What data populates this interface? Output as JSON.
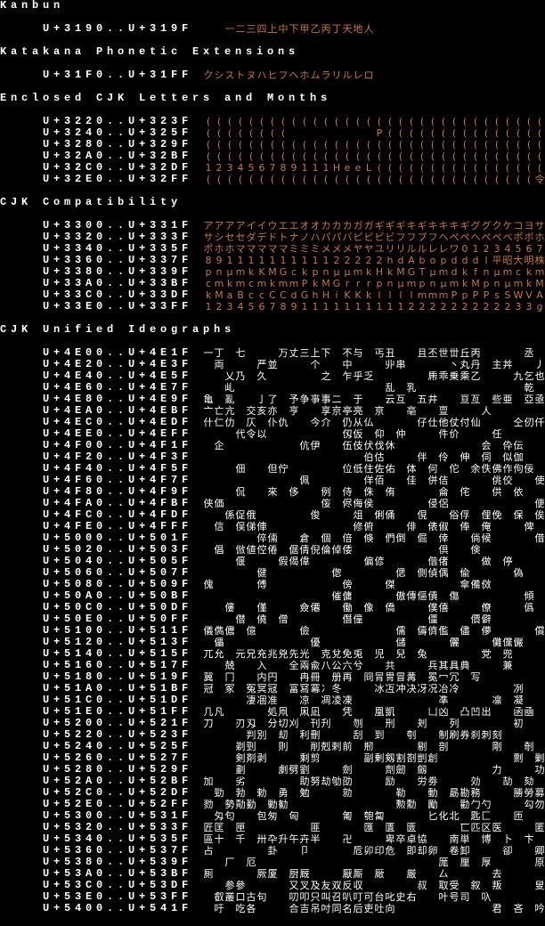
{
  "colors": {
    "background": "#000000",
    "label": "#ffffff",
    "sample_orange": "#c8783a",
    "sample_white": "#ffffff"
  },
  "sections": [
    {
      "title": "Kanbun",
      "color": "#c8783a",
      "rows": [
        {
          "range": "U+3190..U+319F",
          "glyphs": "　　一二三四上中下甲乙丙丁天地人"
        }
      ]
    },
    {
      "title": "Katakana Phonetic Extensions",
      "color": "#c8783a",
      "rows": [
        {
          "range": "U+31F0..U+31FF",
          "glyphs": "クシストヌハヒフヘホムラリルレロ"
        }
      ]
    },
    {
      "title": "Enclosed CJK Letters and Months",
      "color": "#c8783a",
      "rows": [
        {
          "range": "U+3220..U+323F",
          "glyphs": "(((((((((((((((((((((((((((((((("
        },
        {
          "range": "U+3240..U+325F",
          "glyphs": "((((((((　　　　　　　　P((((((((((((((("
        },
        {
          "range": "U+3280..U+329F",
          "glyphs": "(((((((((((((((((((((((((((((((("
        },
        {
          "range": "U+32A0..U+32BF",
          "glyphs": "(((((((((((((((((((((((((((((((("
        },
        {
          "range": "U+32C0..U+32DF",
          "glyphs": "123456789111HeeL(((((((((((((((("
        },
        {
          "range": "U+32E0..U+32FF",
          "glyphs": "(((((((((((((((((((((((((((((((令"
        }
      ]
    },
    {
      "title": "CJK Compatibility",
      "color": "#c8783a",
      "rows": [
        {
          "range": "U+3300..U+331F",
          "glyphs": "アアアアイイウエエオオカカカガガギギギキギキキキギググクケコヨサ"
        },
        {
          "range": "U+3320..U+333F",
          "glyphs": "サシセセダデドトナノハパパバピピピビフフプフヘペペヘペペベポボホ"
        },
        {
          "range": "U+3340..U+335F",
          "glyphs": "ポホホマママママミミミメメメヤヤユリリルルレレワ01234567"
        },
        {
          "range": "U+3360..U+337F",
          "glyphs": "89111111111122222hdAbopdddI平昭大明株"
        },
        {
          "range": "U+3380..U+339F",
          "glyphs": "pnμmkKMGckpnμμmkHkMGTμmdkfnμmckm"
        },
        {
          "range": "U+33A0..U+33BF",
          "glyphs": "cmkmcmkmmPkMGrrrpnμmpnμmkMpnμmkM"
        },
        {
          "range": "U+33C0..U+33DF",
          "glyphs": "kMaBccCCdGhHiKKkllllmmmPpPPsSWVA"
        },
        {
          "range": "U+33E0..U+33FF",
          "glyphs": "1234567891111111111222222222233g"
        }
      ]
    },
    {
      "title": "CJK Unified Ideographs",
      "color": "#ffffff",
      "rows": [
        {
          "range": "U+4E00..U+4E1F",
          "glyphs": "一丁　七　　　万丈三上下　不与　丐丑　　且丕世丗丘丙　　　　丞　"
        },
        {
          "range": "U+4E20..U+4E3F",
          "glyphs": "　両　　　严並　　　个　　中　　　丱串　　　　丶丸丹　主丼　　丿"
        },
        {
          "range": "U+4E40..U+4E5F",
          "glyphs": "　　乂乃　久　　　　　之　乍乎乏　　　　　乕乖乗乘乙　　　九乞也"
        },
        {
          "range": "U+4E60..U+4E7F",
          "glyphs": "　　乢　　　　　　　　　　　　　　乱　乳　　　　　　　　　　乾　"
        },
        {
          "range": "U+4E80..U+4E9F",
          "glyphs": "亀　亂　　亅了　予争亊事二　于　　云互　五井　　亘亙　些亜　亞亟"
        },
        {
          "range": "U+4EA0..U+4EBF",
          "glyphs": "亠亡亢　交亥亦　亨　　享京亭亮　亰　　亳　　亶　　　人　　　　　"
        },
        {
          "range": "U+4EC0..U+4EDF",
          "glyphs": "什仁仂　仄　仆仇　　今介　仍从仏　　　　仔仕他仗付仙　　　仝仞仟"
        },
        {
          "range": "U+4EE0..U+4EFF",
          "glyphs": "　　　代令以　　　　　　　仭仮　仰　仲　　　件价　　　任　　　　"
        },
        {
          "range": "U+4F00..U+4F1F",
          "glyphs": "　企　　　　　　　伉伊　　伍伎伏伐休　　　　　　　　会　伜伝　　"
        },
        {
          "range": "U+4F20..U+4F3F",
          "glyphs": "　　　　　　　　　　　　　　　伯估　　　伴　伶　伸　伺　似伽　　"
        },
        {
          "range": "U+4F40..U+4F5F",
          "glyphs": "　　　佃　　但佇　　　　　位低住佐佑　体　何　佗　余佚佛作佝佞　"
        },
        {
          "range": "U+4F60..U+4F7F",
          "glyphs": "　　　　　　　　　佩　　　　　佯佰　　佳　併佶　　　　佻佼　　使"
        },
        {
          "range": "U+4F80..U+4F9F",
          "glyphs": "　　　侃　　來　侈　　例　侍　侏　侑　　　　侖　侘　　供　依　　"
        },
        {
          "range": "U+4FA0..U+4FBF",
          "glyphs": "侠価　　　　　　　　　侫　侭侮侯　　　　　侵侶　　　　　　　　便"
        },
        {
          "range": "U+4FC0..U+4FDF",
          "glyphs": "　　係促俄　　　　　俊　　　俎　俐俑　　俔　　俗俘　俚俛　保　俟"
        },
        {
          "range": "U+4FE0..U+4FFF",
          "glyphs": "　信　俣俤俥　　　　　　　　修俯　　　俳　俵俶　俸　俺　　　俾　"
        },
        {
          "range": "U+5000..U+501F",
          "glyphs": "　　　　　倅倆　　倉　個　倍　倏　們倒　倔　倖　　倘候　　　　借"
        },
        {
          "range": "U+5020..U+503F",
          "glyphs": "　倡　倣値倥倦　倨倩倪倫倬倭　　　　　　　　倶　　倹　　　　　　"
        },
        {
          "range": "U+5040..U+505F",
          "glyphs": "　　　偃　　　假偈偉　　　　　偏偐　　　　偕偖　　　做　停　　　"
        },
        {
          "range": "U+5060..U+507F",
          "glyphs": "　　　　　健　　　　　　偬　　　　　偲　側偵偶　偸　　　　偽　　"
        },
        {
          "range": "U+5080..U+509F",
          "glyphs": "傀　　　　傅　　　　　　　傍　　　傑　　　　　　傘備傚　　　　　"
        },
        {
          "range": "U+50A0..U+50BF",
          "glyphs": "　　　　　　　　　　　　催傭　　　　傲傳傴債　傷　　　　　　傾　"
        },
        {
          "range": "U+50C0..U+50DF",
          "glyphs": "　　僂　　僅　　　僉僊　　働　像　僑　　　僕僖　　　僚　　　僞　"
        },
        {
          "range": "U+50E0..U+50FF",
          "glyphs": "　　　僣　僥　僧　　　　　僭僮　　　　　　僵　　　價僻　　　　　"
        },
        {
          "range": "U+5100..U+511F",
          "glyphs": "儀儁儂　億　　　　儉　　　　　　　　儒　儔儕儖　儘　儚　　　　償"
        },
        {
          "range": "U+5120..U+513F",
          "glyphs": "　儡　　　　　　　　優　　　　　　　儲　　　　儷　　　儺儻儼　　儿"
        },
        {
          "range": "U+5140..U+515F",
          "glyphs": "兀允　元兄充兆兇先光　克兌免兎　児　兒　兔　　　　　党　兜　　　"
        },
        {
          "range": "U+5160..U+517F",
          "glyphs": "　　兢　　入　　全兩兪八公六兮　　共　　　兵其具典　　　兼　　　"
        },
        {
          "range": "U+5180..U+519F",
          "glyphs": "冀　冂　　内円　　冉冊　册再　冏冐冑冒冓　冕冖冗　写　　　　　　"
        },
        {
          "range": "U+51A0..U+51BF",
          "glyphs": "冠　冢　冤冥冦　冨冩冪冫冬　　　冰冱冲决冴况冶冷　　　　　冽　　"
        },
        {
          "range": "U+51C0..U+51DF",
          "glyphs": "　　　　凄凅准　　凉　凋凌凍　　　　　　　　凖　　　　凛　凝　　"
        },
        {
          "range": "U+51E0..U+51FF",
          "glyphs": "几凡　　　　処凧　凩凪　　凭　　凰凱　　　凵凶　凸凹出　　函凾　"
        },
        {
          "range": "U+5200..U+521F",
          "glyphs": "刀　　刃刄　分切刈　刊刋　　刎　　刑　　刔　　列　　　　　初　　"
        },
        {
          "range": "U+5220..U+523F",
          "glyphs": "　　　　判別　刧　利刪　　　刮　到　　刳　　制刷券刹刺刻　　　　"
        },
        {
          "range": "U+5240..U+525F",
          "glyphs": "　　　剃剄　　則　　削剋剌前　剏　　　　剔　剖　　　　剛　　剞　"
        },
        {
          "range": "U+5260..U+527F",
          "glyphs": "　　　剣剤剥　　　剩剪　　　　副剰剱割剳剴創　　　　　　　剽　剿"
        },
        {
          "range": "U+5280..U+529F",
          "glyphs": "　　　劃　　　劇劈劉　　　劍　　　劑劒　劔　　　　　　力　　　功"
        },
        {
          "range": "U+52A0..U+52BF",
          "glyphs": "加　　劣　　　　　助努劫劬劭　　　励　　労劵　　　効　　劼　劾　"
        },
        {
          "range": "U+52C0..U+52DF",
          "glyphs": "　勁　勃　勅　勇　勉　　　勍　　　　勒　　動　勗勘務　　　勝勞募"
        },
        {
          "range": "U+52E0..U+52FF",
          "glyphs": "勠　勢勣勤　勦勧　　　　　　　　　　勲勳　勵　　勸勹勺　　　勾勿"
        },
        {
          "range": "U+5300..U+531F",
          "glyphs": "　匁匂　　包匆　匈　　　　匍　匏匐　　　　匕化北　匙匚　　匝　　"
        },
        {
          "range": "U+5320..U+533F",
          "glyphs": "匠匡　匣　　　　　　匪　　　　匯　匱　匳　　　　匸匹区医　　　匿"
        },
        {
          "range": "U+5340..U+535F",
          "glyphs": "區十　千　卅卆升午卉半　　卍　　　卑卒卓協　　南単　博　卜　卞　"
        },
        {
          "range": "U+5360..U+537F",
          "glyphs": "占　　　　　卦　　卩　　　　卮卯印危　即却卵　卷卸　　　卻　　卿"
        },
        {
          "range": "U+5380..U+539F",
          "glyphs": "　　厂　厄　　　　　　　　　　　　　　　　　厖　厘　厚　　　　原"
        },
        {
          "range": "U+53A0..U+53BF",
          "glyphs": "厠　　　　厥厦　厨厩　　　厭厮　厰　　厳　　厶　　　　去　　　　"
        },
        {
          "range": "U+53C0..U+53DF",
          "glyphs": "　　参參　　　　又叉及友双反収　　　　　叔　取受　叙　叛　　　叟"
        },
        {
          "range": "U+53E0..U+53FF",
          "glyphs": "　叡叢口古句　　叨叩只叫召叭叮可台叱史右　　叶号司　叺　　　　　"
        },
        {
          "range": "U+5400..U+541F",
          "glyphs": "　吁　吃各　　　合吉吊吋同名后吏吐向　　　　　　　　　君　吝　吟"
        }
      ]
    }
  ]
}
